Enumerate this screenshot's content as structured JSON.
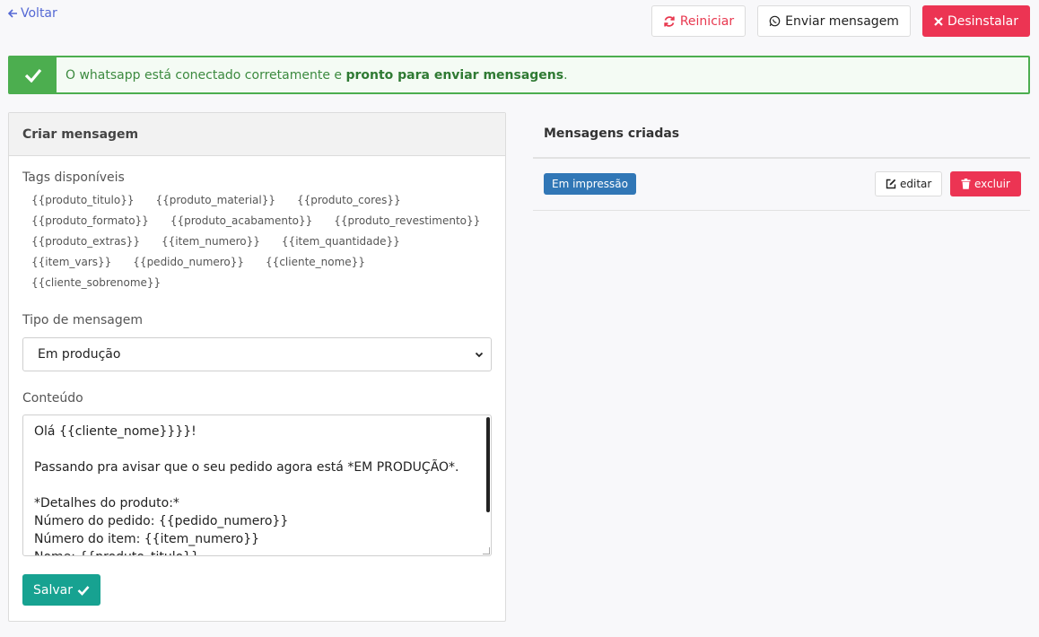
{
  "nav": {
    "back_label": "Voltar"
  },
  "toolbar": {
    "restart_label": "Reiniciar",
    "send_label": "Enviar mensagem",
    "uninstall_label": "Desinstalar"
  },
  "alert": {
    "text_prefix": "O whatsapp está conectado corretamente e ",
    "text_strong": "pronto para enviar mensagens",
    "text_suffix": "."
  },
  "create_panel": {
    "title": "Criar mensagem",
    "tags_label": "Tags disponíveis",
    "tags": [
      "{{produto_titulo}}",
      "{{produto_material}}",
      "{{produto_cores}}",
      "{{produto_formato}}",
      "{{produto_acabamento}}",
      "{{produto_revestimento}}",
      "{{produto_extras}}",
      "{{item_numero}}",
      "{{item_quantidade}}",
      "{{item_vars}}",
      "{{pedido_numero}}",
      "{{cliente_nome}}",
      "{{cliente_sobrenome}}"
    ],
    "type_label": "Tipo de mensagem",
    "type_selected": "Em produção",
    "content_label": "Conteúdo",
    "content_lines": [
      "Olá {{cliente_nome}}}}!",
      "",
      "Passando pra avisar que o seu pedido agora está *EM PRODUÇÃO*.",
      "",
      "*Detalhes do produto:*",
      "Número do pedido: {{pedido_numero}}",
      "Número do item: {{item_numero}}",
      "Nome: {{produto_titulo}}"
    ],
    "save_label": "Salvar"
  },
  "created_panel": {
    "title": "Mensagens criadas",
    "messages": [
      {
        "badge": "Em impressão",
        "edit_label": "editar",
        "delete_label": "excluir"
      }
    ]
  },
  "colors": {
    "accent_link": "#5468d4",
    "danger": "#ec3453",
    "success": "#4cae4f",
    "save": "#17a291",
    "badge": "#3177b6"
  }
}
